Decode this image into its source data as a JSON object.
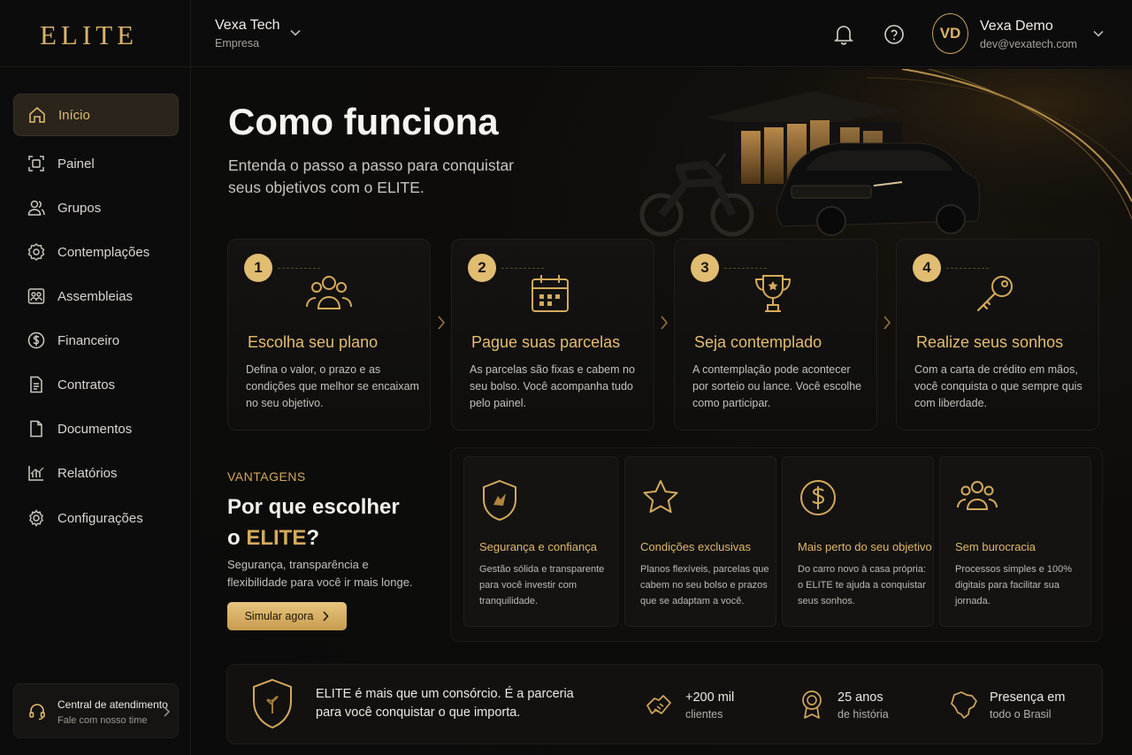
{
  "brand": {
    "logo": "ELITE"
  },
  "company": {
    "name": "Vexa Tech",
    "type": "Empresa"
  },
  "user": {
    "initials": "VD",
    "name": "Vexa Demo",
    "email": "dev@vexatech.com"
  },
  "sidebar": {
    "items": [
      {
        "label": "Início",
        "icon": "home-icon",
        "active": true
      },
      {
        "label": "Painel",
        "icon": "dashboard-icon"
      },
      {
        "label": "Grupos",
        "icon": "users-icon"
      },
      {
        "label": "Contemplações",
        "icon": "badge-icon"
      },
      {
        "label": "Assembleias",
        "icon": "assembly-icon"
      },
      {
        "label": "Financeiro",
        "icon": "dollar-icon"
      },
      {
        "label": "Contratos",
        "icon": "contract-icon"
      },
      {
        "label": "Documentos",
        "icon": "document-icon"
      },
      {
        "label": "Relatórios",
        "icon": "report-icon"
      },
      {
        "label": "Configurações",
        "icon": "gear-icon"
      }
    ],
    "support": {
      "title": "Central de atendimento",
      "subtitle": "Fale com nosso time"
    }
  },
  "hero": {
    "title": "Como funciona",
    "subtitle": "Entenda o passo a passo para conquistar seus objetivos com o ELITE."
  },
  "steps": [
    {
      "number": "1",
      "title": "Escolha seu plano",
      "text": "Defina o valor, o prazo e as condições que melhor se encaixam no seu objetivo.",
      "icon": "people-icon"
    },
    {
      "number": "2",
      "title": "Pague suas parcelas",
      "text": "As parcelas são fixas e cabem no seu bolso. Você acompanha tudo pelo painel.",
      "icon": "calendar-icon"
    },
    {
      "number": "3",
      "title": "Seja contemplado",
      "text": "A contemplação pode acontecer por sorteio ou lance. Você escolhe como participar.",
      "icon": "trophy-icon"
    },
    {
      "number": "4",
      "title": "Realize seus sonhos",
      "text": "Com a carta de crédito em mãos, você conquista o que sempre quis com liberdade.",
      "icon": "key-icon"
    }
  ],
  "advantages": {
    "kicker": "VANTAGENS",
    "title_pre": "Por que escolher",
    "title_o": "o ",
    "title_brand": "ELITE",
    "title_q": "?",
    "subtitle": "Segurança, transparência e flexibilidade para você ir mais longe.",
    "cta": "Simular agora",
    "cards": [
      {
        "title": "Segurança e confiança",
        "text": "Gestão sólida e transparente para você investir com tranquilidade.",
        "icon": "shield-icon"
      },
      {
        "title": "Condições exclusivas",
        "text": "Planos flexíveis, parcelas que cabem no seu bolso e prazos que se adaptam a você.",
        "icon": "star-icon"
      },
      {
        "title": "Mais perto do seu objetivo",
        "text": "Do carro novo à casa própria: o ELITE te ajuda a conquistar seus sonhos.",
        "icon": "dollar-coin-icon"
      },
      {
        "title": "Sem burocracia",
        "text": "Processos simples e 100% digitais para facilitar sua jornada.",
        "icon": "group-icon"
      }
    ]
  },
  "footer": {
    "text": "ELITE é mais que um consórcio. É a parceria para você conquistar o que importa.",
    "stats": [
      {
        "big": "+200 mil",
        "small": "clientes",
        "icon": "handshake-icon"
      },
      {
        "big": "25 anos",
        "small": "de história",
        "icon": "medal-icon"
      },
      {
        "big": "Presença em",
        "small": "todo o Brasil",
        "icon": "brazil-map-icon"
      }
    ]
  },
  "colors": {
    "accent": "#d4aa5c",
    "background": "#0b0b0b",
    "card": "#141311"
  }
}
